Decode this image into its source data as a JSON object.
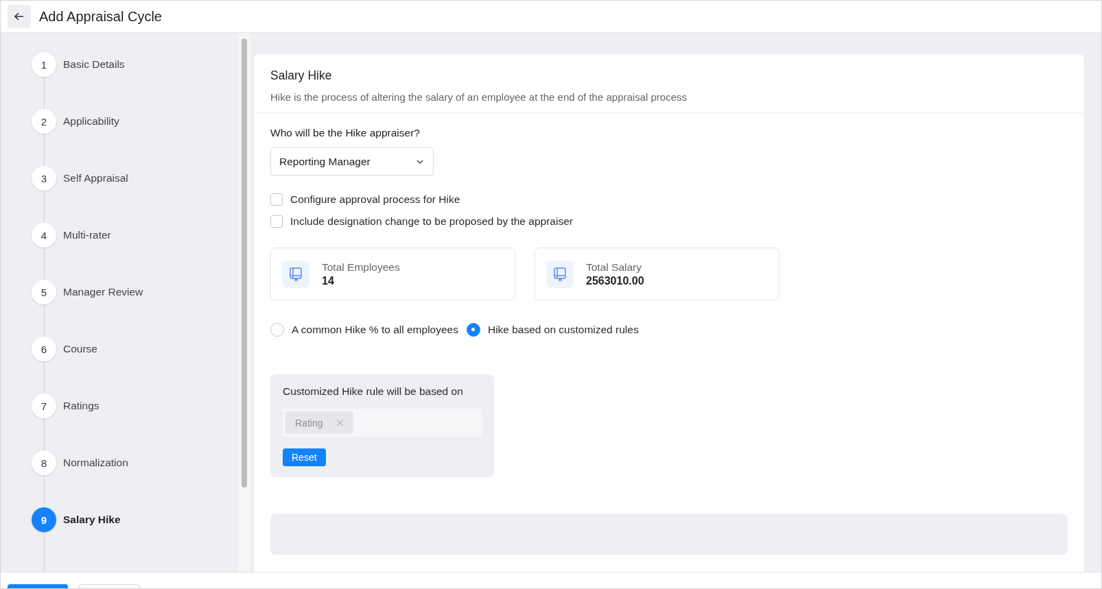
{
  "header": {
    "title": "Add Appraisal Cycle"
  },
  "steps": [
    {
      "number": "1",
      "label": "Basic Details",
      "selected": false
    },
    {
      "number": "2",
      "label": "Applicability",
      "selected": false
    },
    {
      "number": "3",
      "label": "Self Appraisal",
      "selected": false
    },
    {
      "number": "4",
      "label": "Multi-rater",
      "selected": false
    },
    {
      "number": "5",
      "label": "Manager Review",
      "selected": false
    },
    {
      "number": "6",
      "label": "Course",
      "selected": false
    },
    {
      "number": "7",
      "label": "Ratings",
      "selected": false
    },
    {
      "number": "8",
      "label": "Normalization",
      "selected": false
    },
    {
      "number": "9",
      "label": "Salary Hike",
      "selected": true
    }
  ],
  "section": {
    "title": "Salary Hike",
    "description": "Hike is the process of altering the salary of an employee at the end of the appraisal process"
  },
  "appraiser": {
    "question": "Who will be the Hike appraiser?",
    "value": "Reporting Manager"
  },
  "options": [
    {
      "label": "Configure approval process for Hike",
      "checked": false
    },
    {
      "label": "Include designation change to be proposed by the appraiser",
      "checked": false
    }
  ],
  "stats": [
    {
      "label": "Total Employees",
      "value": "14"
    },
    {
      "label": "Total Salary",
      "value": "2563010.00"
    }
  ],
  "hike_modes": [
    {
      "label": "A common Hike % to all employees",
      "selected": false
    },
    {
      "label": "Hike based on customized rules",
      "selected": true
    }
  ],
  "rule_box": {
    "title": "Customized Hike rule will be based on",
    "tags": [
      "Rating"
    ],
    "button": "Reset"
  }
}
